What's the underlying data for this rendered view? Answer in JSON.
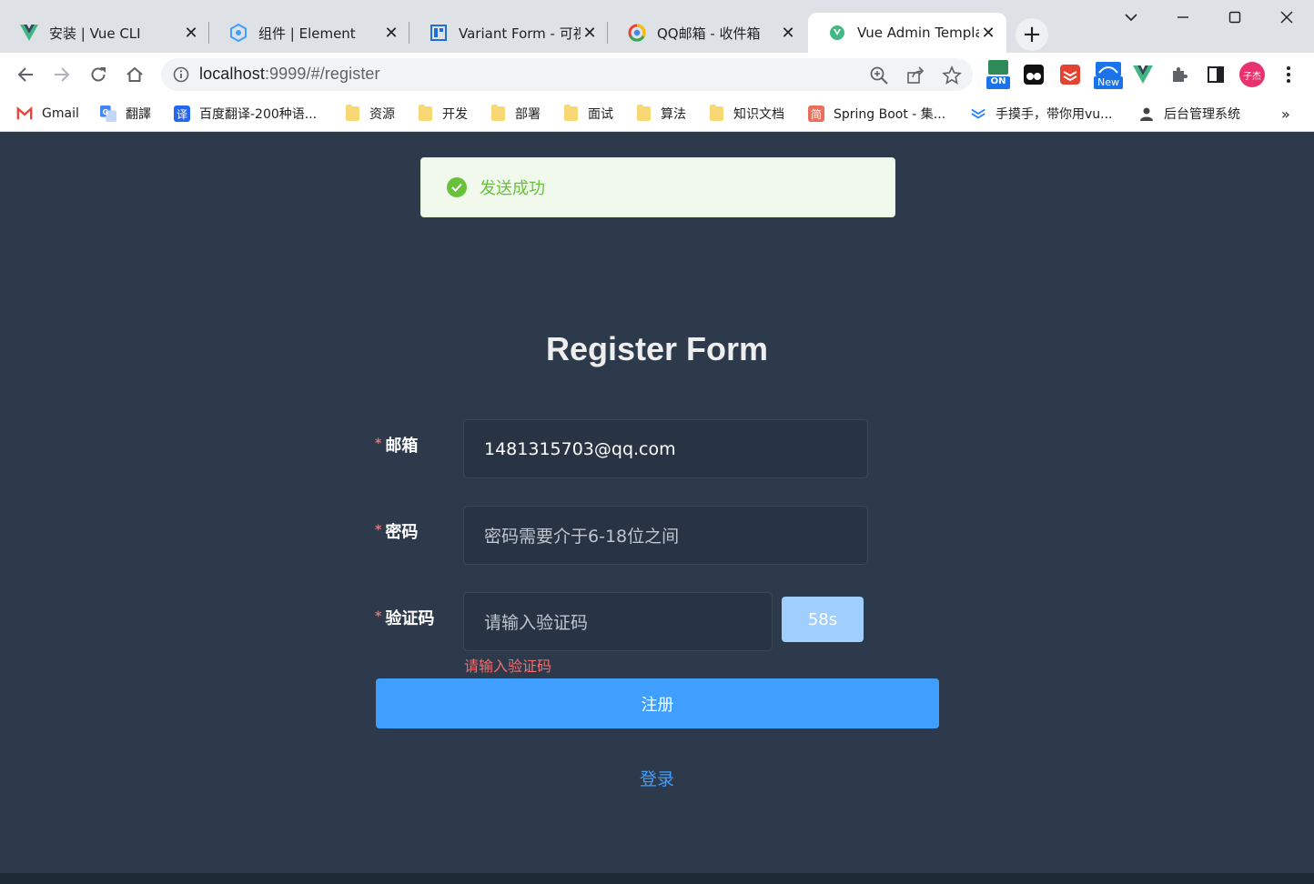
{
  "browser": {
    "tabs": [
      {
        "title": "安装 | Vue CLI",
        "icon": "vue-logo-icon"
      },
      {
        "title": "组件 | Element",
        "icon": "element-logo-icon"
      },
      {
        "title": "Variant Form - 可视",
        "icon": "variant-form-icon"
      },
      {
        "title": "QQ邮箱 - 收件箱",
        "icon": "qq-mail-icon"
      },
      {
        "title": "Vue Admin Templat",
        "icon": "vue-circle-icon",
        "active": true
      }
    ],
    "close_glyph": "✕",
    "new_tab_glyph": "+",
    "address": {
      "host": "localhost",
      "rest": ":9999/#/register"
    },
    "extensions": {
      "on_badge": "ON",
      "new_badge": "New",
      "profile_initials": "子杰"
    },
    "bookmarks": [
      {
        "label": "Gmail",
        "icon": "gmail-icon"
      },
      {
        "label": "翻譯",
        "icon": "google-translate-icon"
      },
      {
        "label": "百度翻译-200种语...",
        "icon": "baidu-translate-icon",
        "glyph": "译"
      },
      {
        "label": "资源",
        "icon": "folder-icon"
      },
      {
        "label": "开发",
        "icon": "folder-icon"
      },
      {
        "label": "部署",
        "icon": "folder-icon"
      },
      {
        "label": "面试",
        "icon": "folder-icon"
      },
      {
        "label": "算法",
        "icon": "folder-icon"
      },
      {
        "label": "知识文档",
        "icon": "folder-icon"
      },
      {
        "label": "Spring Boot - 集...",
        "icon": "jianshu-icon",
        "glyph": "简"
      },
      {
        "label": "手摸手，带你用vu...",
        "icon": "layers-icon"
      },
      {
        "label": "后台管理系统",
        "icon": "person-icon"
      }
    ],
    "more_bookmarks_glyph": "»"
  },
  "toast": {
    "message": "发送成功",
    "color": "#67c23a"
  },
  "form": {
    "title": "Register Form",
    "required_mark": "*",
    "email": {
      "label": "邮箱",
      "value": "1481315703@qq.com"
    },
    "password": {
      "label": "密码",
      "placeholder": "密码需要介于6-18位之间"
    },
    "code": {
      "label": "验证码",
      "placeholder": "请输入验证码",
      "button": "58s",
      "error": "请输入验证码"
    },
    "submit": "注册",
    "login_link": "登录"
  },
  "colors": {
    "background": "#2d3a4b",
    "primary": "#409eff",
    "danger": "#f56c6c",
    "success": "#67c23a"
  }
}
